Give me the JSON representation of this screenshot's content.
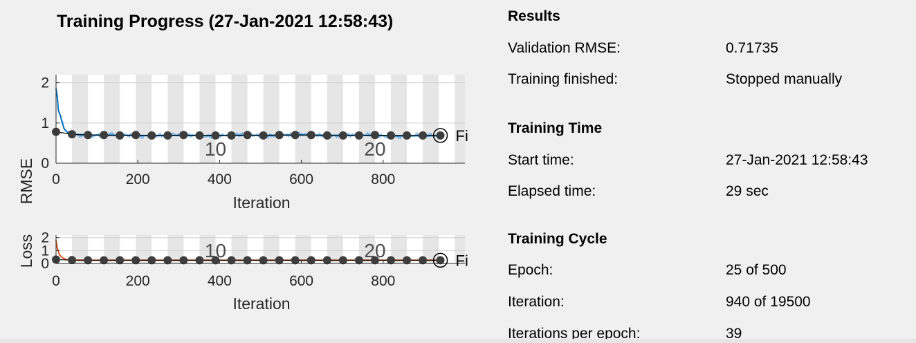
{
  "title": "Training Progress (27-Jan-2021 12:58:43)",
  "colors": {
    "rmse_line": "#0072bd",
    "rmse_raw": "#5aa0e0",
    "loss_line": "#d95319",
    "validation_marker": "#3d3d3d",
    "epoch_band": "#e6e6e6"
  },
  "rmse_chart": {
    "ylabel": "RMSE",
    "xlabel": "Iteration",
    "xticks": [
      "0",
      "200",
      "400",
      "600",
      "800"
    ],
    "yticks": [
      "0",
      "1",
      "2"
    ],
    "epoch_labels": [
      "10",
      "20"
    ],
    "final_label": "Fi"
  },
  "loss_chart": {
    "ylabel": "Loss",
    "xlabel": "Iteration",
    "xticks": [
      "0",
      "200",
      "400",
      "600",
      "800"
    ],
    "yticks": [
      "0",
      "1",
      "2"
    ],
    "epoch_labels": [
      "10",
      "20"
    ],
    "final_label": "Fi"
  },
  "results": {
    "heading": "Results",
    "validation_rmse_label": "Validation RMSE:",
    "validation_rmse_value": "0.71735",
    "training_finished_label": "Training finished:",
    "training_finished_value": "Stopped manually"
  },
  "training_time": {
    "heading": "Training Time",
    "start_time_label": "Start time:",
    "start_time_value": "27-Jan-2021 12:58:43",
    "elapsed_time_label": "Elapsed time:",
    "elapsed_time_value": "29 sec"
  },
  "training_cycle": {
    "heading": "Training Cycle",
    "epoch_label": "Epoch:",
    "epoch_value": "25 of 500",
    "iteration_label": "Iteration:",
    "iteration_value": "940 of 19500",
    "iter_per_epoch_label": "Iterations per epoch:",
    "iter_per_epoch_value": "39"
  },
  "chart_data": [
    {
      "type": "line",
      "title": "Training Progress (27-Jan-2021 12:58:43)",
      "xlabel": "Iteration",
      "ylabel": "RMSE",
      "xlim": [
        0,
        1000
      ],
      "ylim": [
        0,
        2.2
      ],
      "grid": true,
      "epoch_size": 39,
      "epoch_markers": [
        {
          "label": "10",
          "iteration": 390
        },
        {
          "label": "20",
          "iteration": 780
        }
      ],
      "series": [
        {
          "values": [
            [
              0,
              1.85
            ],
            [
              3,
              1.65
            ],
            [
              6,
              1.3
            ],
            [
              10,
              1.2
            ],
            [
              14,
              1.05
            ],
            [
              20,
              0.85
            ],
            [
              30,
              0.75
            ],
            [
              40,
              0.72
            ],
            [
              80,
              0.7
            ],
            [
              200,
              0.69
            ],
            [
              400,
              0.69
            ],
            [
              600,
              0.7
            ],
            [
              780,
              0.69
            ],
            [
              820,
              0.68
            ],
            [
              880,
              0.68
            ],
            [
              940,
              0.68
            ]
          ]
        },
        {
          "values": [
            [
              0,
              0.78
            ],
            [
              39,
              0.72
            ],
            [
              78,
              0.7
            ],
            [
              117,
              0.7
            ],
            [
              156,
              0.69
            ],
            [
              195,
              0.7
            ],
            [
              234,
              0.69
            ],
            [
              273,
              0.69
            ],
            [
              312,
              0.7
            ],
            [
              351,
              0.69
            ],
            [
              390,
              0.69
            ],
            [
              429,
              0.69
            ],
            [
              468,
              0.7
            ],
            [
              507,
              0.69
            ],
            [
              546,
              0.7
            ],
            [
              585,
              0.7
            ],
            [
              624,
              0.7
            ],
            [
              663,
              0.69
            ],
            [
              702,
              0.69
            ],
            [
              741,
              0.69
            ],
            [
              780,
              0.7
            ],
            [
              819,
              0.69
            ],
            [
              858,
              0.69
            ],
            [
              897,
              0.69
            ],
            [
              940,
              0.69
            ]
          ]
        }
      ]
    },
    {
      "type": "line",
      "xlabel": "Iteration",
      "ylabel": "Loss",
      "xlim": [
        0,
        1000
      ],
      "ylim": [
        0,
        2.2
      ],
      "grid": true,
      "epoch_size": 39,
      "epoch_markers": [
        {
          "label": "10",
          "iteration": 390
        },
        {
          "label": "20",
          "iteration": 780
        }
      ],
      "series": [
        {
          "values": [
            [
              0,
              1.8
            ],
            [
              3,
              1.2
            ],
            [
              8,
              0.7
            ],
            [
              15,
              0.45
            ],
            [
              25,
              0.3
            ],
            [
              40,
              0.27
            ],
            [
              100,
              0.25
            ],
            [
              300,
              0.25
            ],
            [
              600,
              0.25
            ],
            [
              940,
              0.25
            ]
          ]
        },
        {
          "values": [
            [
              0,
              0.3
            ],
            [
              39,
              0.26
            ],
            [
              78,
              0.25
            ],
            [
              117,
              0.25
            ],
            [
              156,
              0.25
            ],
            [
              195,
              0.25
            ],
            [
              234,
              0.25
            ],
            [
              273,
              0.25
            ],
            [
              312,
              0.25
            ],
            [
              351,
              0.25
            ],
            [
              390,
              0.25
            ],
            [
              429,
              0.25
            ],
            [
              468,
              0.25
            ],
            [
              507,
              0.25
            ],
            [
              546,
              0.25
            ],
            [
              585,
              0.25
            ],
            [
              624,
              0.25
            ],
            [
              663,
              0.25
            ],
            [
              702,
              0.25
            ],
            [
              741,
              0.25
            ],
            [
              780,
              0.25
            ],
            [
              819,
              0.25
            ],
            [
              858,
              0.25
            ],
            [
              897,
              0.25
            ],
            [
              940,
              0.25
            ]
          ]
        }
      ]
    }
  ]
}
